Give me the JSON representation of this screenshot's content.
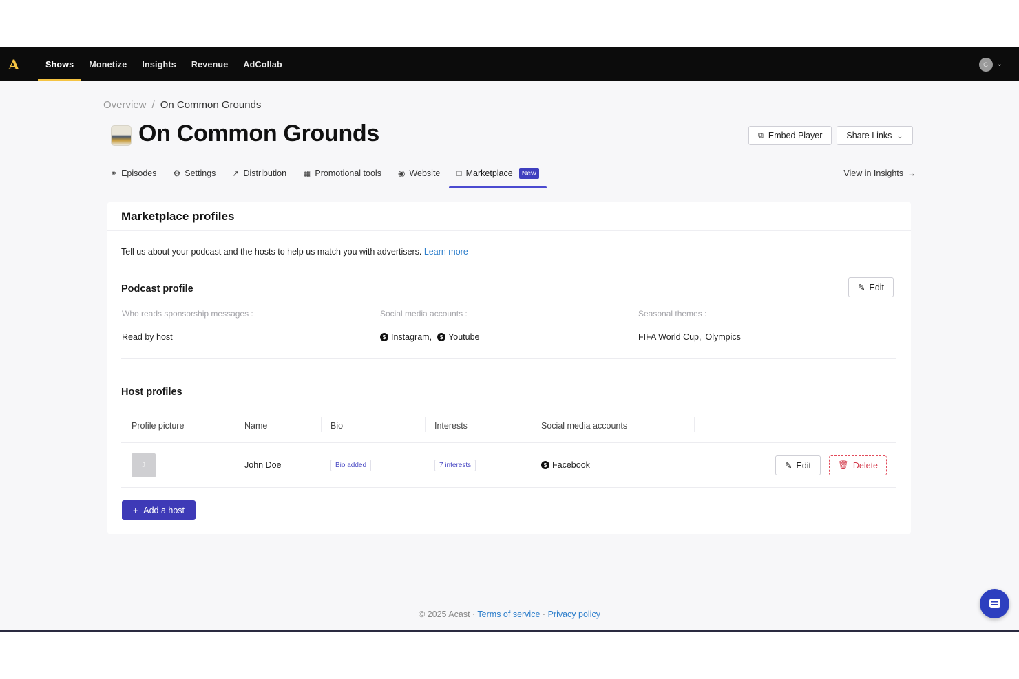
{
  "nav": {
    "logo": "A",
    "items": [
      {
        "label": "Shows",
        "active": true
      },
      {
        "label": "Monetize"
      },
      {
        "label": "Insights"
      },
      {
        "label": "Revenue"
      },
      {
        "label": "AdCollab"
      }
    ],
    "avatar_initial": "G"
  },
  "breadcrumb": {
    "root": "Overview",
    "sep": "/",
    "current": "On Common Grounds"
  },
  "page": {
    "title": "On Common Grounds"
  },
  "header_buttons": {
    "embed": "Embed Player",
    "share": "Share Links"
  },
  "tabs": [
    {
      "label": "Episodes",
      "icon": "headphones-icon"
    },
    {
      "label": "Settings",
      "icon": "gear-icon"
    },
    {
      "label": "Distribution",
      "icon": "rocket-icon"
    },
    {
      "label": "Promotional tools",
      "icon": "grid-icon"
    },
    {
      "label": "Website",
      "icon": "globe-icon"
    },
    {
      "label": "Marketplace",
      "icon": "chat-icon",
      "active": true,
      "badge": "New"
    }
  ],
  "view_insights": "View in Insights",
  "card": {
    "title": "Marketplace profiles",
    "intro": "Tell us about your podcast and the hosts to help us match you with advertisers.",
    "learn_more": "Learn more",
    "podcast_profile": {
      "title": "Podcast profile",
      "edit": "Edit",
      "fields": [
        {
          "label": "Who reads sponsorship messages :",
          "value": "Read by host"
        },
        {
          "label": "Social media accounts :",
          "values": [
            "Instagram,",
            "Youtube"
          ]
        },
        {
          "label": "Seasonal themes :",
          "values": [
            "FIFA World Cup,",
            "Olympics"
          ]
        }
      ]
    },
    "host_profiles": {
      "title": "Host profiles",
      "columns": [
        "Profile picture",
        "Name",
        "Bio",
        "Interests",
        "Social media accounts"
      ],
      "rows": [
        {
          "initial": "J",
          "name": "John Doe",
          "bio": "Bio added",
          "interests": "7 interests",
          "social": "Facebook",
          "edit": "Edit",
          "delete": "Delete"
        }
      ],
      "add": "Add a host"
    }
  },
  "footer": {
    "copyright": "© 2025 Acast ·",
    "terms": "Terms of service",
    "dot": "·",
    "privacy": "Privacy policy"
  },
  "colors": {
    "accent": "#3e3ab7",
    "nav_bg": "#0c0c0c",
    "logo": "#f5c443",
    "link": "#2d7ecb",
    "danger": "#d33a4b"
  }
}
